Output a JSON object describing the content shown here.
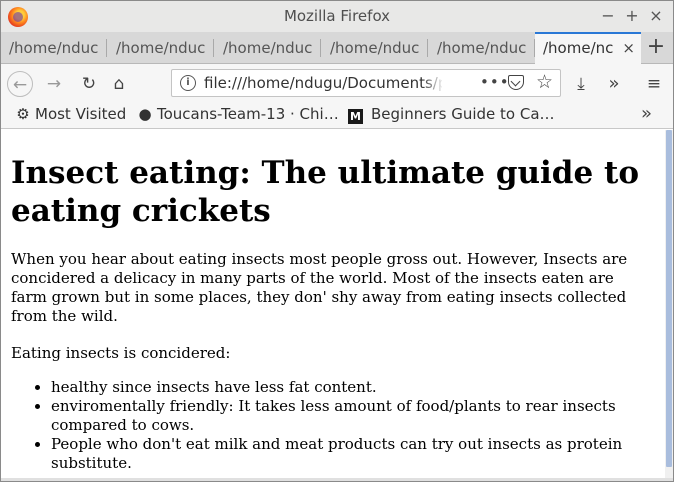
{
  "window": {
    "title": "Mozilla Firefox",
    "controls": {
      "minimize": "−",
      "maximize": "+",
      "close": "×"
    }
  },
  "tabs": [
    {
      "label": "/home/nduc",
      "active": false
    },
    {
      "label": "/home/nduc",
      "active": false
    },
    {
      "label": "/home/nduc",
      "active": false
    },
    {
      "label": "/home/nduc",
      "active": false
    },
    {
      "label": "/home/nduc",
      "active": false
    },
    {
      "label": "/home/nc",
      "active": true
    }
  ],
  "tab_close_glyph": "×",
  "new_tab_glyph": "+",
  "nav": {
    "back_glyph": "←",
    "forward_glyph": "→",
    "reload_glyph": "↻",
    "home_glyph": "⌂",
    "url": "file:///home/ndugu/Documents/pr",
    "page_actions_glyph": "•••",
    "star_glyph": "☆",
    "download_glyph": "⤓",
    "overflow_glyph": "»",
    "menu_glyph": "≡"
  },
  "bookmarks": {
    "items": [
      {
        "label": "Most Visited",
        "icon": "gear-icon",
        "glyph": "⚙"
      },
      {
        "label": "Toucans-Team-13 · Chi…",
        "icon": "github-icon",
        "glyph": "●"
      },
      {
        "label": "Beginners Guide to Ca…",
        "icon": "medium-icon",
        "glyph": "M"
      }
    ],
    "more_glyph": "»"
  },
  "article": {
    "heading": "Insect eating: The ultimate guide to eating crickets",
    "paragraph1": "When you hear about eating insects most people gross out. However, Insects are concidered a delicacy in many parts of the world. Most of the insects eaten are farm grown but in some places, they don' shy away from eating insects collected from the wild.",
    "paragraph2": "Eating insects is concidered:",
    "list": [
      "healthy since insects have less fat content.",
      "enviromentally friendly: It takes less amount of food/plants to rear insects compared to cows.",
      "People who don't eat milk and meat products can try out insects as protein substitute."
    ]
  },
  "colors": {
    "active_tab_accent": "#2a78d6",
    "scroll_thumb": "#a9bddd"
  }
}
